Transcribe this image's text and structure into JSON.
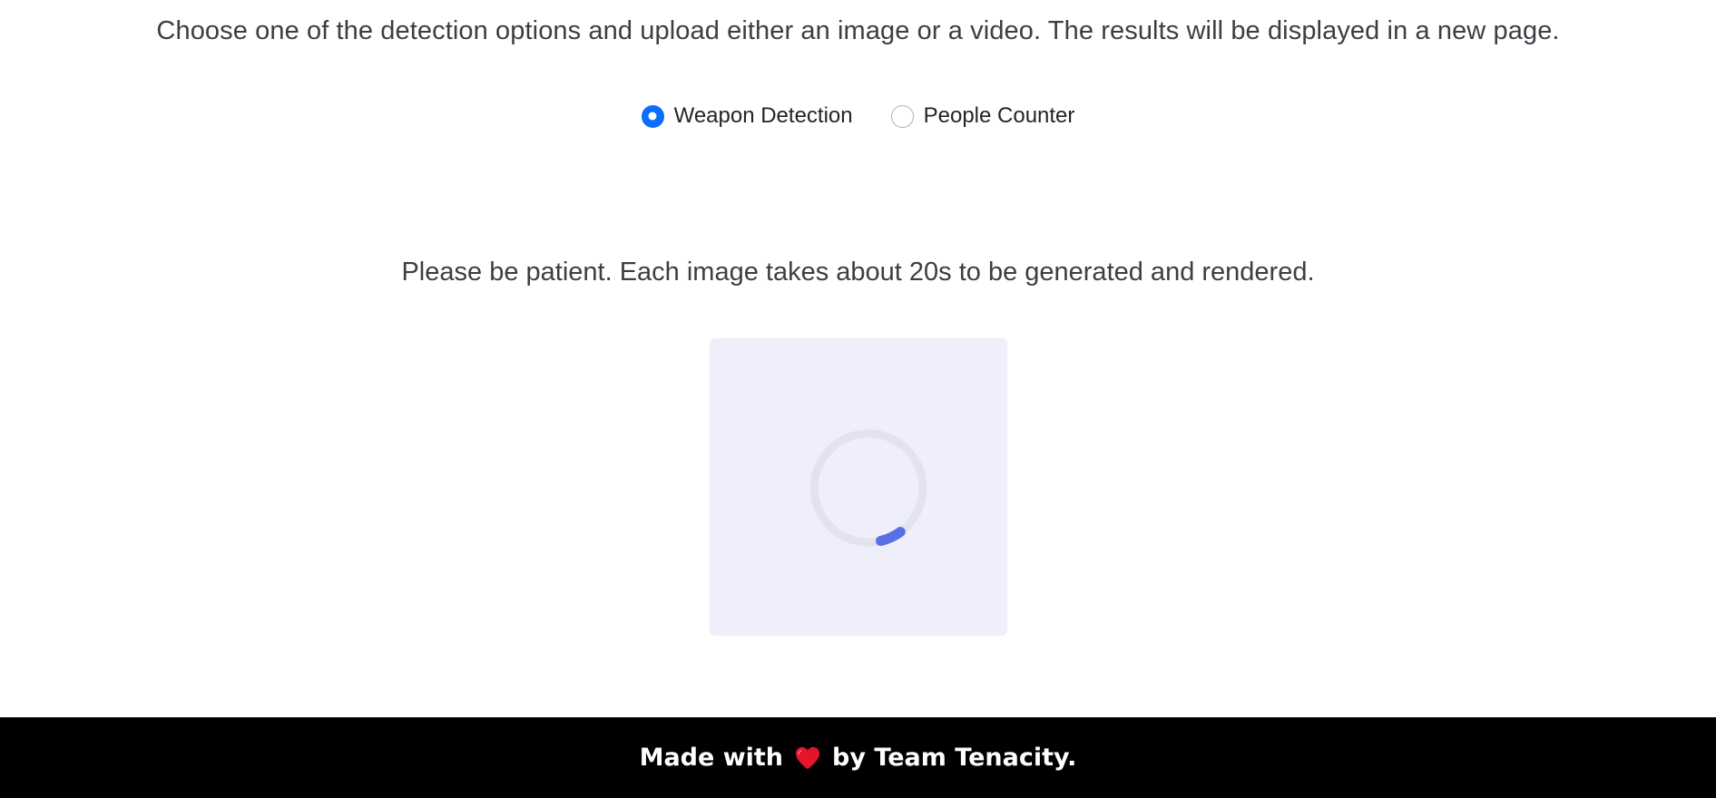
{
  "intro": {
    "text": "Choose one of the detection options and upload either an image or a video. The results will be displayed in a new page."
  },
  "detection_options": [
    {
      "label": "Weapon Detection",
      "checked": true
    },
    {
      "label": "People Counter",
      "checked": false
    }
  ],
  "status": {
    "message": "Please be patient. Each image takes about 20s to be generated and rendered."
  },
  "loader": {
    "icon": "loading-spinner-icon",
    "track_color": "#e3e3ef",
    "arc_color": "#5a6ee6"
  },
  "footer": {
    "prefix": "Made with",
    "icon": "heart-icon",
    "suffix": "by Team Tenacity.",
    "heart_color": "#e3152b"
  },
  "colors": {
    "accent": "#0d6efd",
    "footer_bg": "#000000",
    "loader_bg": "#efeffb"
  }
}
